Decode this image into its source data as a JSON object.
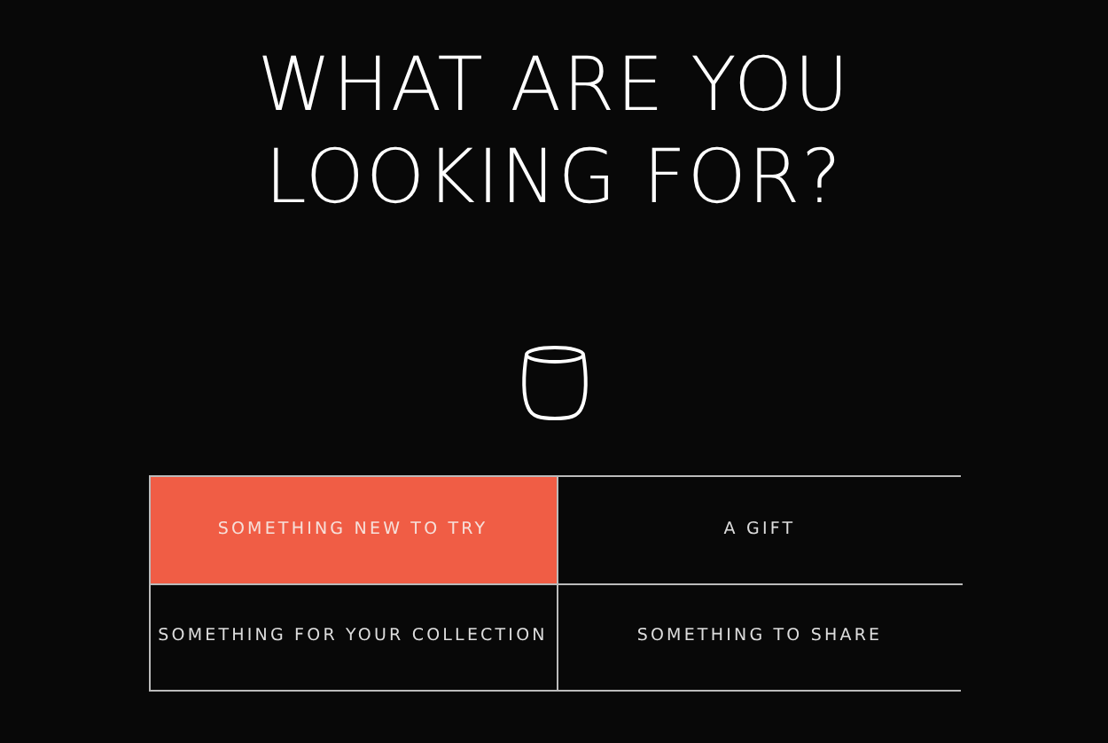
{
  "heading": [
    "WHAT ARE YOU",
    "LOOKING FOR?"
  ],
  "options": [
    {
      "label": "SOMETHING NEW TO TRY",
      "selected": true
    },
    {
      "label": "A GIFT",
      "selected": false
    },
    {
      "label": "SOMETHING FOR YOUR COLLECTION",
      "selected": false
    },
    {
      "label": "SOMETHING TO SHARE",
      "selected": false
    }
  ]
}
